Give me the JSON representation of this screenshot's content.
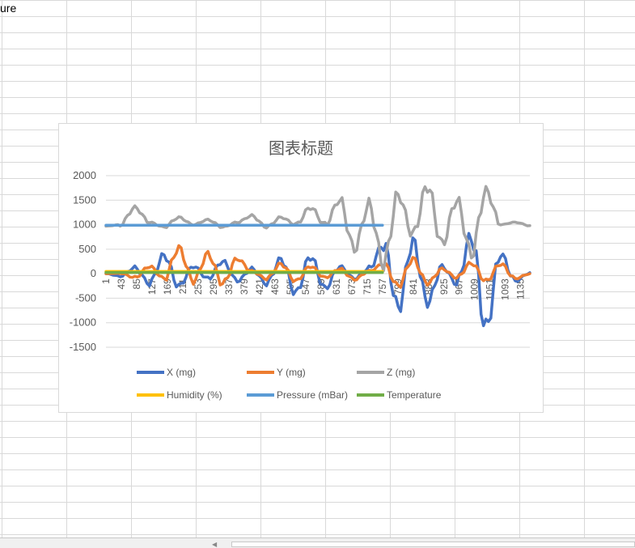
{
  "sheet": {
    "cell_a1": "ure"
  },
  "chart_data": {
    "type": "line",
    "title": "图表标题",
    "xlabel": "",
    "ylabel": "",
    "ylim": [
      -1500,
      2000
    ],
    "yticks": [
      2000,
      1500,
      1000,
      500,
      0,
      -500,
      -1000,
      -1500
    ],
    "grid": true,
    "legend_position": "bottom",
    "x_ticks": [
      1,
      43,
      85,
      127,
      169,
      211,
      253,
      295,
      337,
      379,
      421,
      463,
      505,
      547,
      589,
      631,
      673,
      715,
      757,
      799,
      841,
      883,
      925,
      967,
      1009,
      1051,
      1093,
      1135
    ],
    "x": [
      1,
      40,
      80,
      120,
      160,
      200,
      240,
      280,
      320,
      360,
      400,
      440,
      480,
      520,
      560,
      600,
      640,
      680,
      720,
      760,
      800,
      840,
      880,
      920,
      960,
      1000,
      1040,
      1080,
      1120,
      1160
    ],
    "series": [
      {
        "name": "X (mg)",
        "color": "#4472C4",
        "values": [
          0,
          -50,
          120,
          -200,
          380,
          -250,
          150,
          -100,
          250,
          -150,
          100,
          -200,
          300,
          -400,
          350,
          -300,
          150,
          -100,
          100,
          600,
          -700,
          650,
          -600,
          150,
          -200,
          780,
          -1100,
          400,
          -150,
          20
        ]
      },
      {
        "name": "Y (mg)",
        "color": "#ED7D31",
        "values": [
          0,
          10,
          -80,
          150,
          -100,
          520,
          -150,
          400,
          -200,
          300,
          50,
          -100,
          200,
          -150,
          150,
          -80,
          100,
          -120,
          50,
          200,
          -250,
          300,
          -200,
          100,
          -80,
          220,
          -150,
          200,
          -100,
          0
        ]
      },
      {
        "name": "Z (mg)",
        "color": "#A5A5A5",
        "values": [
          970,
          1000,
          1350,
          1050,
          950,
          1150,
          1000,
          1100,
          950,
          1050,
          1180,
          950,
          1150,
          1000,
          1350,
          1000,
          1500,
          500,
          1400,
          200,
          1600,
          800,
          1800,
          600,
          1500,
          400,
          1700,
          1000,
          1050,
          980
        ]
      },
      {
        "name": "Humidity (%)",
        "color": "#FFC000",
        "x": [
          1,
          757
        ],
        "values": [
          45,
          45
        ]
      },
      {
        "name": "Pressure (mBar)",
        "color": "#5B9BD5",
        "x": [
          1,
          757
        ],
        "values": [
          990,
          990
        ]
      },
      {
        "name": "Temperature",
        "color": "#70AD47",
        "x": [
          1,
          757
        ],
        "values": [
          25,
          25
        ]
      }
    ]
  }
}
